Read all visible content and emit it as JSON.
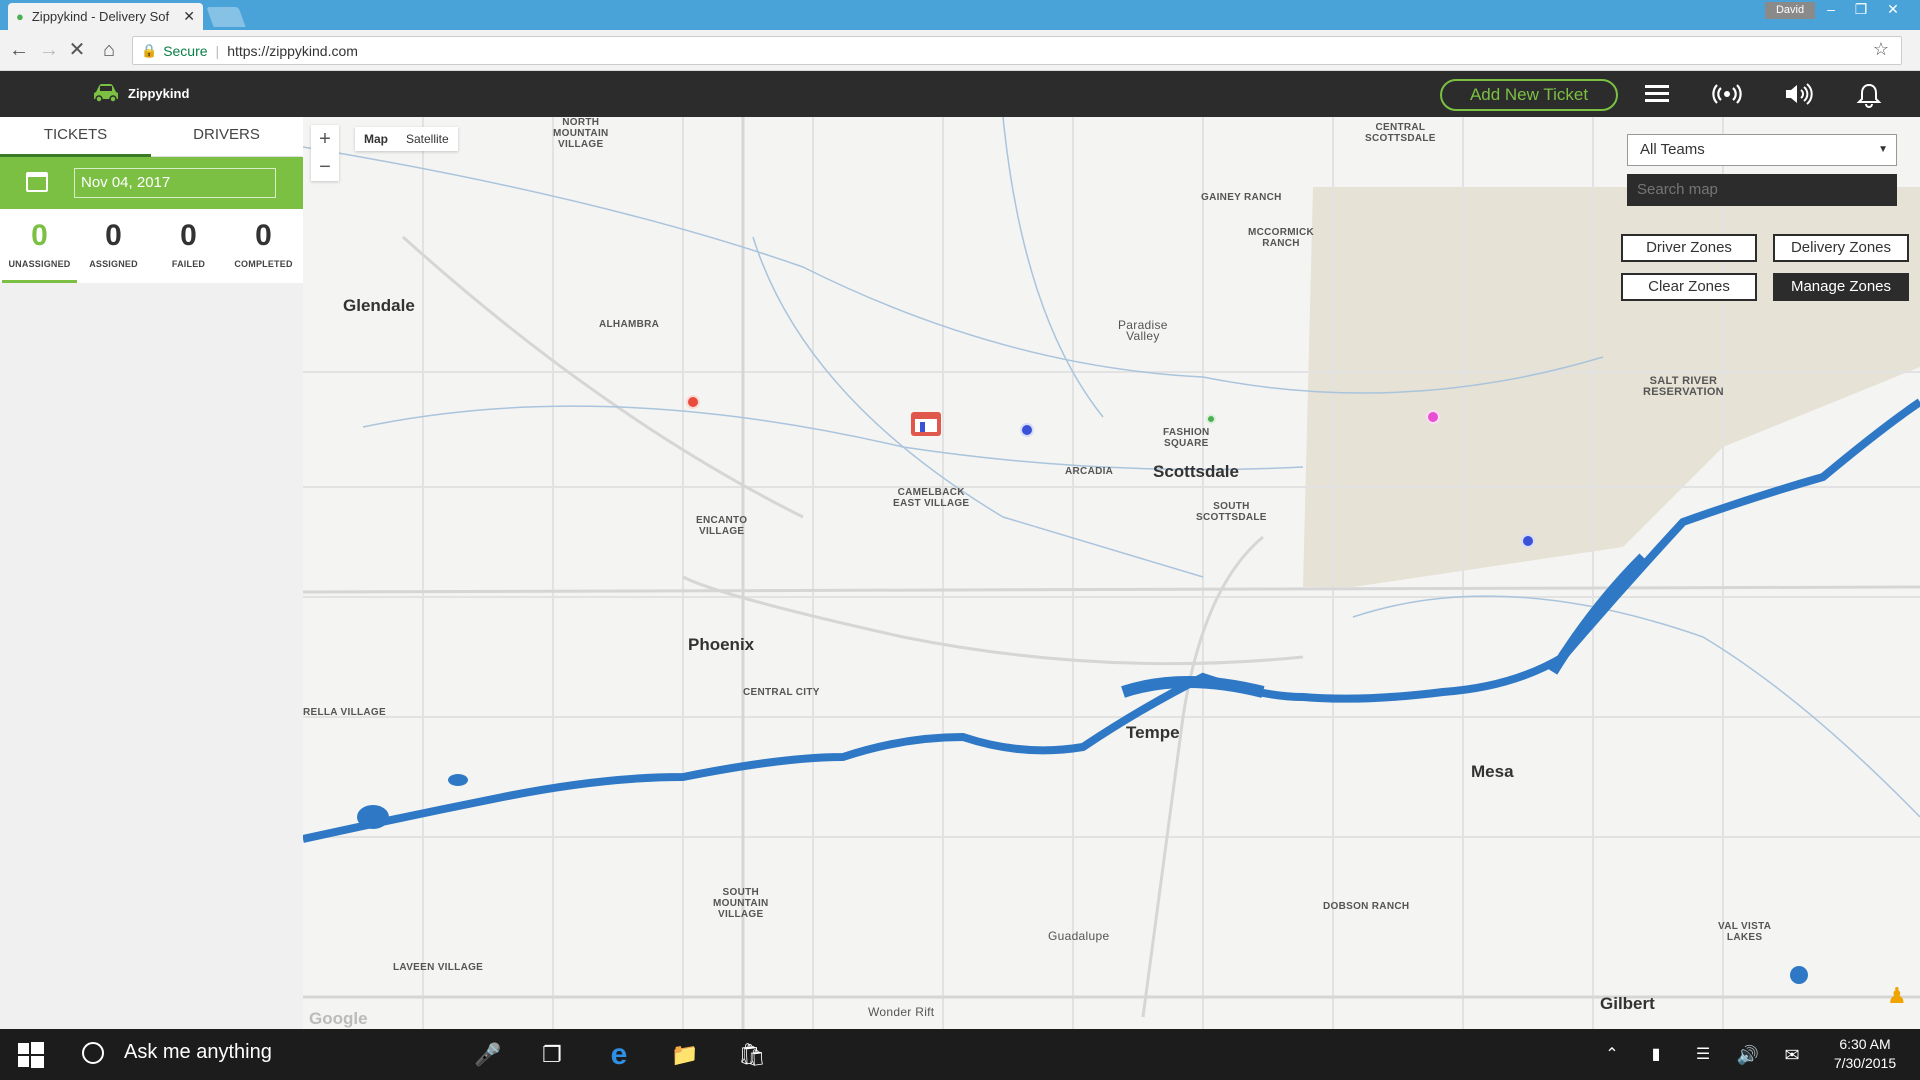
{
  "browser": {
    "tab_title": "Zippykind - Delivery Sof",
    "user": "David",
    "secure_label": "Secure",
    "url": "https://zippykind.com"
  },
  "app": {
    "brand": "Zippykind",
    "add_ticket_label": "Add New Ticket",
    "accent_color": "#7bc043"
  },
  "sidebar": {
    "tabs": [
      "TICKETS",
      "DRIVERS"
    ],
    "date": "Nov 04, 2017",
    "stats": [
      {
        "value": "0",
        "label": "UNASSIGNED"
      },
      {
        "value": "0",
        "label": "ASSIGNED"
      },
      {
        "value": "0",
        "label": "FAILED"
      },
      {
        "value": "0",
        "label": "COMPLETED"
      }
    ]
  },
  "map": {
    "type_options": [
      "Map",
      "Satellite"
    ],
    "zoom_in": "+",
    "zoom_out": "−",
    "team_select": "All Teams",
    "search_placeholder": "Search map",
    "buttons": {
      "driver_zones": "Driver Zones",
      "delivery_zones": "Delivery Zones",
      "clear_zones": "Clear Zones",
      "manage_zones": "Manage Zones"
    },
    "cities": {
      "glendale": "Glendale",
      "phoenix": "Phoenix",
      "scottsdale": "Scottsdale",
      "tempe": "Tempe",
      "mesa": "Mesa",
      "gilbert": "Gilbert",
      "paradise_valley": "Paradise\nValley",
      "guadalupe": "Guadalupe",
      "wonder_rift": "Wonder Rift"
    },
    "areas": {
      "north_mountain": "NORTH\nMOUNTAIN\nVILLAGE",
      "alhambra": "ALHAMBRA",
      "encanto": "ENCANTO\nVILLAGE",
      "camelback": "CAMELBACK\nEAST VILLAGE",
      "arcadia": "ARCADIA",
      "fashion_square": "FASHION\nSQUARE",
      "south_scottsdale": "SOUTH\nSCOTTSDALE",
      "gainey": "GAINEY RANCH",
      "mccormick": "MCCORMICK\nRANCH",
      "central_scottsdale": "CENTRAL\nSCOTTSDALE",
      "salt_river": "SALT RIVER\nRESERVATION",
      "central_city": "CENTRAL CITY",
      "estrella": "RELLA VILLAGE",
      "south_mountain": "SOUTH\nMOUNTAIN\nVILLAGE",
      "laveen": "LAVEEN VILLAGE",
      "dobson": "DOBSON RANCH",
      "val_vista": "VAL VISTA\nLAKES"
    },
    "attribution": "Google",
    "pin_colors": [
      "#e94c3d",
      "#3b52d8",
      "#e84fd0",
      "#3b52d8",
      "#4caf50"
    ]
  },
  "taskbar": {
    "search_text": "Ask me anything",
    "time": "6:30 AM",
    "date": "7/30/2015"
  }
}
